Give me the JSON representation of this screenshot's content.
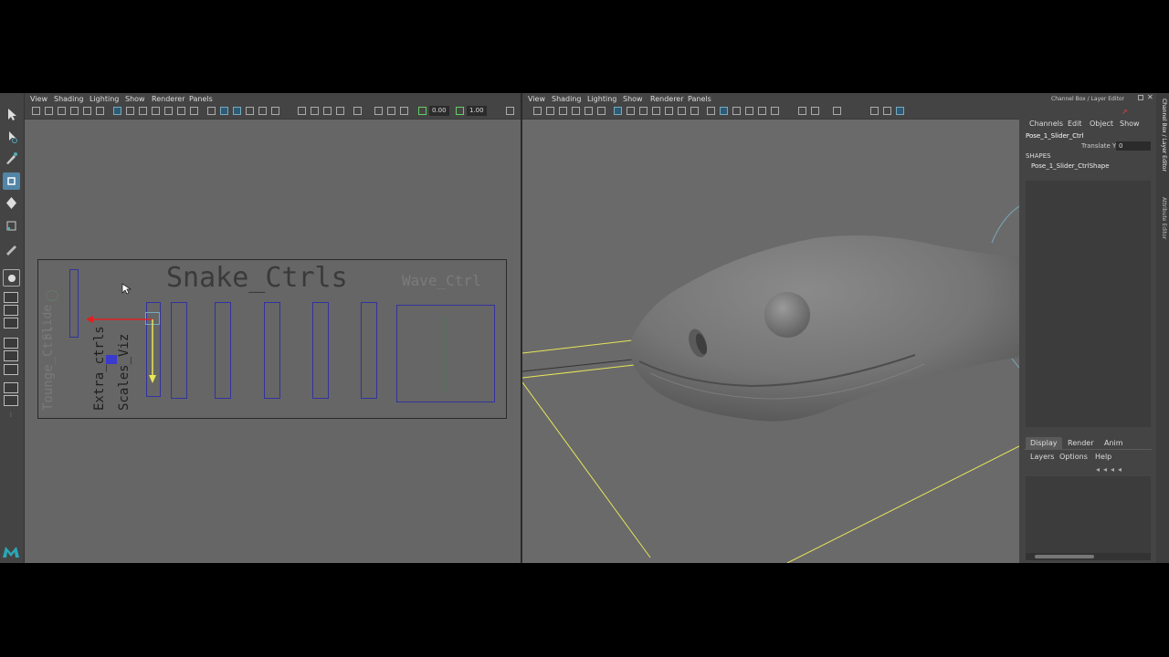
{
  "viewport_menu": [
    "View",
    "Shading",
    "Lighting",
    "Show",
    "Renderer",
    "Panels"
  ],
  "toolbar_fields": {
    "value_a": "0.00",
    "value_b": "1.00"
  },
  "left_view": {
    "title": "Snake_Ctrls",
    "wave_label": "Wave_Ctrl",
    "vertical_labels": [
      "Tounge_Ctrl",
      "Slide",
      "Extra_ctrls",
      "Scales_Viz"
    ]
  },
  "channel_box": {
    "title": "Channel Box / Layer Editor",
    "menu": [
      "Channels",
      "Edit",
      "Object",
      "Show"
    ],
    "node": "Pose_1_Slider_Ctrl",
    "attribute_label": "Translate Y",
    "attribute_value": "0",
    "shapes_label": "SHAPES",
    "shape_name": "Pose_1_Slider_CtrlShape"
  },
  "side_tabs": [
    "Channel Box / Layer Editor",
    "Attribute Editor"
  ],
  "layer_editor": {
    "tabs": [
      "Display",
      "Render",
      "Anim"
    ],
    "active_tab": "Display",
    "menu": [
      "Layers",
      "Options",
      "Help"
    ]
  },
  "colors": {
    "selection_blue": "#5285a6",
    "wire_yellow": "#e6e65a",
    "curve_blue": "#3232a0",
    "axis_red": "#e02020"
  }
}
